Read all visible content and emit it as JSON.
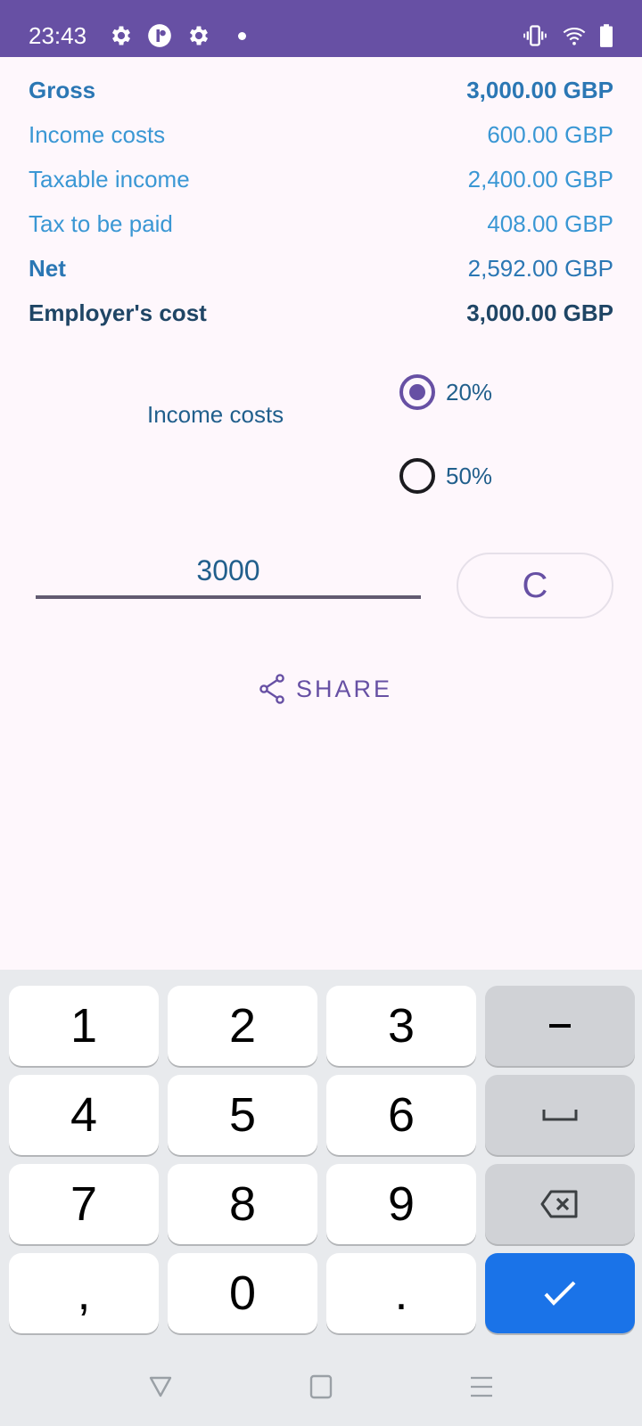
{
  "status_bar": {
    "time": "23:43",
    "left_icons": [
      "settings-gear-icon",
      "app-notification-icon",
      "settings-gear-icon",
      "notification-dot-icon"
    ],
    "right_icons": [
      "vibrate-icon",
      "wifi-icon",
      "battery-icon"
    ]
  },
  "colors": {
    "primary": "#6750a4",
    "label_dark_blue": "#2b77b4",
    "label_light_blue": "#3a97d4",
    "label_navy": "#1f4565",
    "text_blue": "#215f8c",
    "enter_key": "#1a73e8"
  },
  "results": [
    {
      "label": "Gross",
      "value": "3,000.00 GBP",
      "style": "bold",
      "color": "#2b77b4"
    },
    {
      "label": "Income costs",
      "value": "600.00 GBP",
      "style": "normal",
      "color": "#3a97d4"
    },
    {
      "label": "Taxable income",
      "value": "2,400.00 GBP",
      "style": "normal",
      "color": "#3a97d4"
    },
    {
      "label": "Tax to be paid",
      "value": "408.00 GBP",
      "style": "normal",
      "color": "#3a97d4"
    },
    {
      "label": "Net",
      "value": "2,592.00 GBP",
      "style": "net",
      "color": "#2b77b4"
    },
    {
      "label": "Employer's cost",
      "value": "3,000.00 GBP",
      "style": "bold",
      "color": "#1f4565"
    }
  ],
  "income_costs": {
    "label": "Income costs",
    "options": [
      {
        "label": "20%",
        "checked": true
      },
      {
        "label": "50%",
        "checked": false
      }
    ]
  },
  "amount": {
    "value": "3000",
    "clear_label": "C"
  },
  "share": {
    "label": "SHARE"
  },
  "keyboard": {
    "keys": [
      [
        "1",
        "2",
        "3",
        "−"
      ],
      [
        "4",
        "5",
        "6",
        "space"
      ],
      [
        "7",
        "8",
        "9",
        "backspace"
      ],
      [
        ",",
        "0",
        ".",
        "enter"
      ]
    ]
  },
  "navbar": {
    "buttons": [
      "back",
      "home",
      "menu"
    ]
  }
}
